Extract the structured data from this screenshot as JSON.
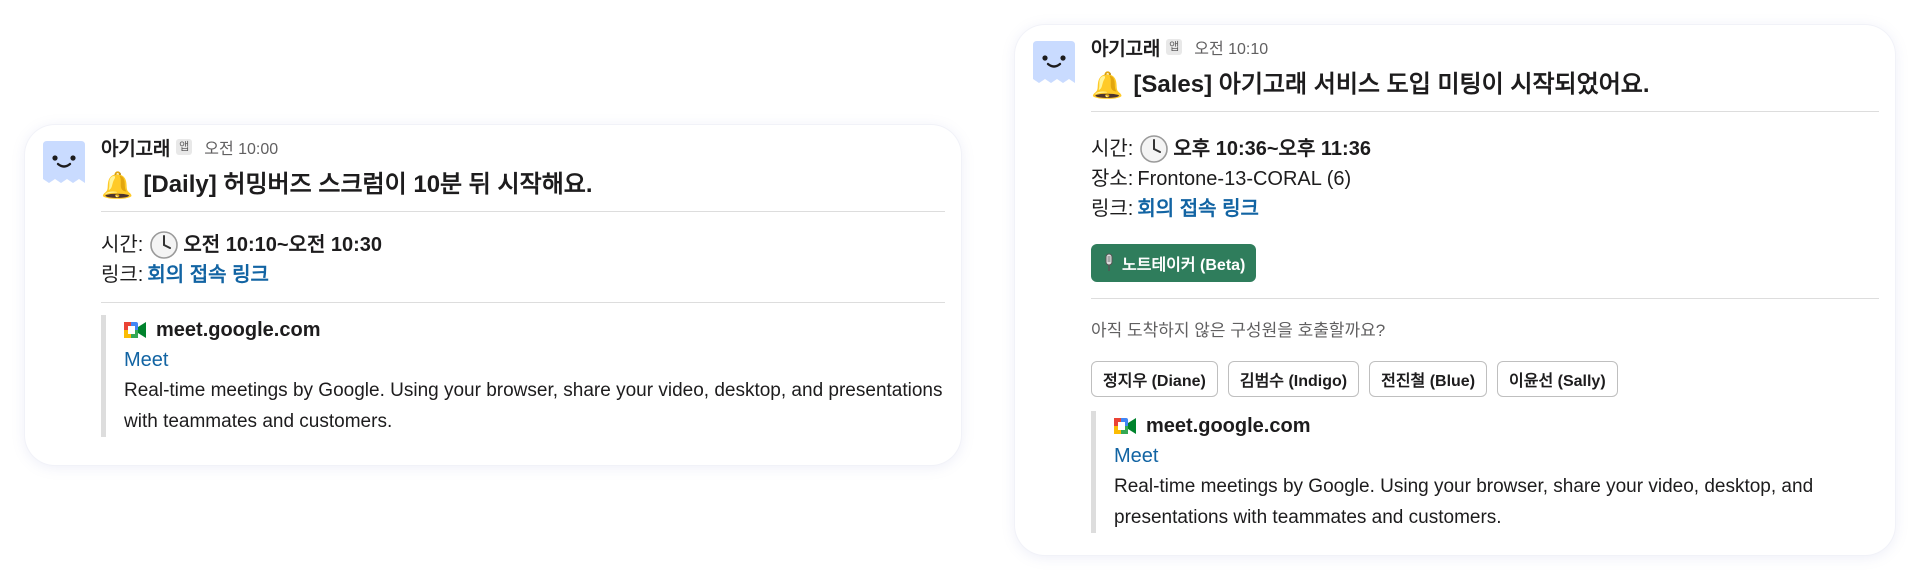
{
  "messages": [
    {
      "sender": "아기고래",
      "app_badge": "앱",
      "timestamp": "오전 10:00",
      "title": "[Daily] 허밍버즈 스크럼이 10분 뒤 시작해요.",
      "time_label": "시간:",
      "time_value": "오전 10:10~오전 10:30",
      "link_label": "링크:",
      "link_text": "회의 접속 링크",
      "attachment": {
        "site": "meet.google.com",
        "title": "Meet",
        "description": "Real-time meetings by Google. Using your browser, share your video, desktop, and presentations with teammates and customers."
      }
    },
    {
      "sender": "아기고래",
      "app_badge": "앱",
      "timestamp": "오전 10:10",
      "title": "[Sales] 아기고래 서비스 도입 미팅이 시작되었어요.",
      "time_label": "시간:",
      "time_value": "오후 10:36~오후 11:36",
      "place_label": "장소:",
      "place_value": "Frontone-13-CORAL (6)",
      "link_label": "링크:",
      "link_text": "회의 접속 링크",
      "notetaker_button": "노트테이커 (Beta)",
      "call_prompt": "아직 도착하지 않은 구성원을 호출할까요?",
      "members": [
        "정지우 (Diane)",
        "김범수 (Indigo)",
        "전진철 (Blue)",
        "이윤선 (Sally)"
      ],
      "attachment": {
        "site": "meet.google.com",
        "title": "Meet",
        "description": "Real-time meetings by Google. Using your browser, share your video, desktop, and presentations with teammates and customers."
      }
    }
  ],
  "icons": {
    "avatar": "whale-face-avatar",
    "bell": "bell-icon",
    "clock": "clock-icon",
    "meet": "google-meet-icon",
    "mic": "microphone-icon"
  },
  "colors": {
    "link": "#1264a3",
    "primary_button": "#2f7d5c",
    "avatar_bg": "#c9dbff"
  }
}
